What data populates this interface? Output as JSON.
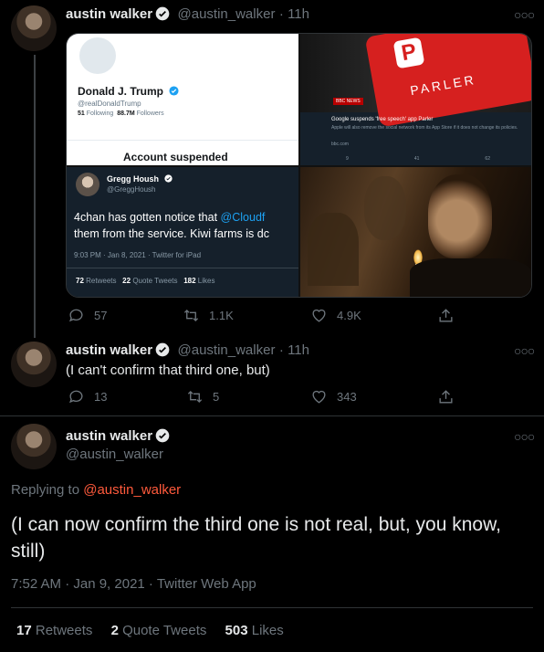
{
  "tweet1": {
    "name": "austin walker",
    "handle": "@austin_walker",
    "time": "· 11h",
    "media": {
      "tl": {
        "name": "Donald J. Trump",
        "handle": "@realDonaldTrump",
        "following_num": "51",
        "following_lbl": "Following",
        "followers_num": "88.7M",
        "followers_lbl": "Followers",
        "suspended": "Account suspended"
      },
      "tr": {
        "brand": "PARLER",
        "bbc": "BBC NEWS",
        "headline": "Google suspends 'free speech' app Parler",
        "sub": "Apple will also remove the social network from its App Store if it does not change its policies.",
        "source": "bbc.com",
        "reply": "9",
        "rt": "41",
        "like": "62"
      },
      "bl": {
        "name": "Gregg Housh",
        "handle": "@GreggHoush",
        "text_a": "4chan has gotten notice that ",
        "mention": "@Cloudf",
        "text_b": "them from the service. Kiwi farms is dc",
        "meta": "9:03 PM · Jan 8, 2021 · Twitter for iPad",
        "rt_num": "72",
        "rt_lbl": "Retweets",
        "qt_num": "22",
        "qt_lbl": "Quote Tweets",
        "like_num": "182",
        "like_lbl": "Likes"
      }
    },
    "replies": "57",
    "retweets": "1.1K",
    "likes": "4.9K"
  },
  "tweet2": {
    "name": "austin walker",
    "handle": "@austin_walker",
    "time": "· 11h",
    "text": "(I can't confirm that third one, but)",
    "replies": "13",
    "retweets": "5",
    "likes": "343"
  },
  "tweet3": {
    "name": "austin walker",
    "handle": "@austin_walker",
    "replying_prefix": "Replying to ",
    "replying_to": "@austin_walker",
    "text": "(I can now confirm the third one is not real, but, you know, still)",
    "meta": "7:52 AM · Jan 9, 2021 · Twitter Web App",
    "retweets_num": "17",
    "retweets_lbl": "Retweets",
    "quotes_num": "2",
    "quotes_lbl": "Quote Tweets",
    "likes_num": "503",
    "likes_lbl": "Likes"
  },
  "colors": {
    "link": "#1da1f2",
    "mention": "#ff5a3c",
    "bg": "#000000",
    "muted": "#6e767d"
  }
}
